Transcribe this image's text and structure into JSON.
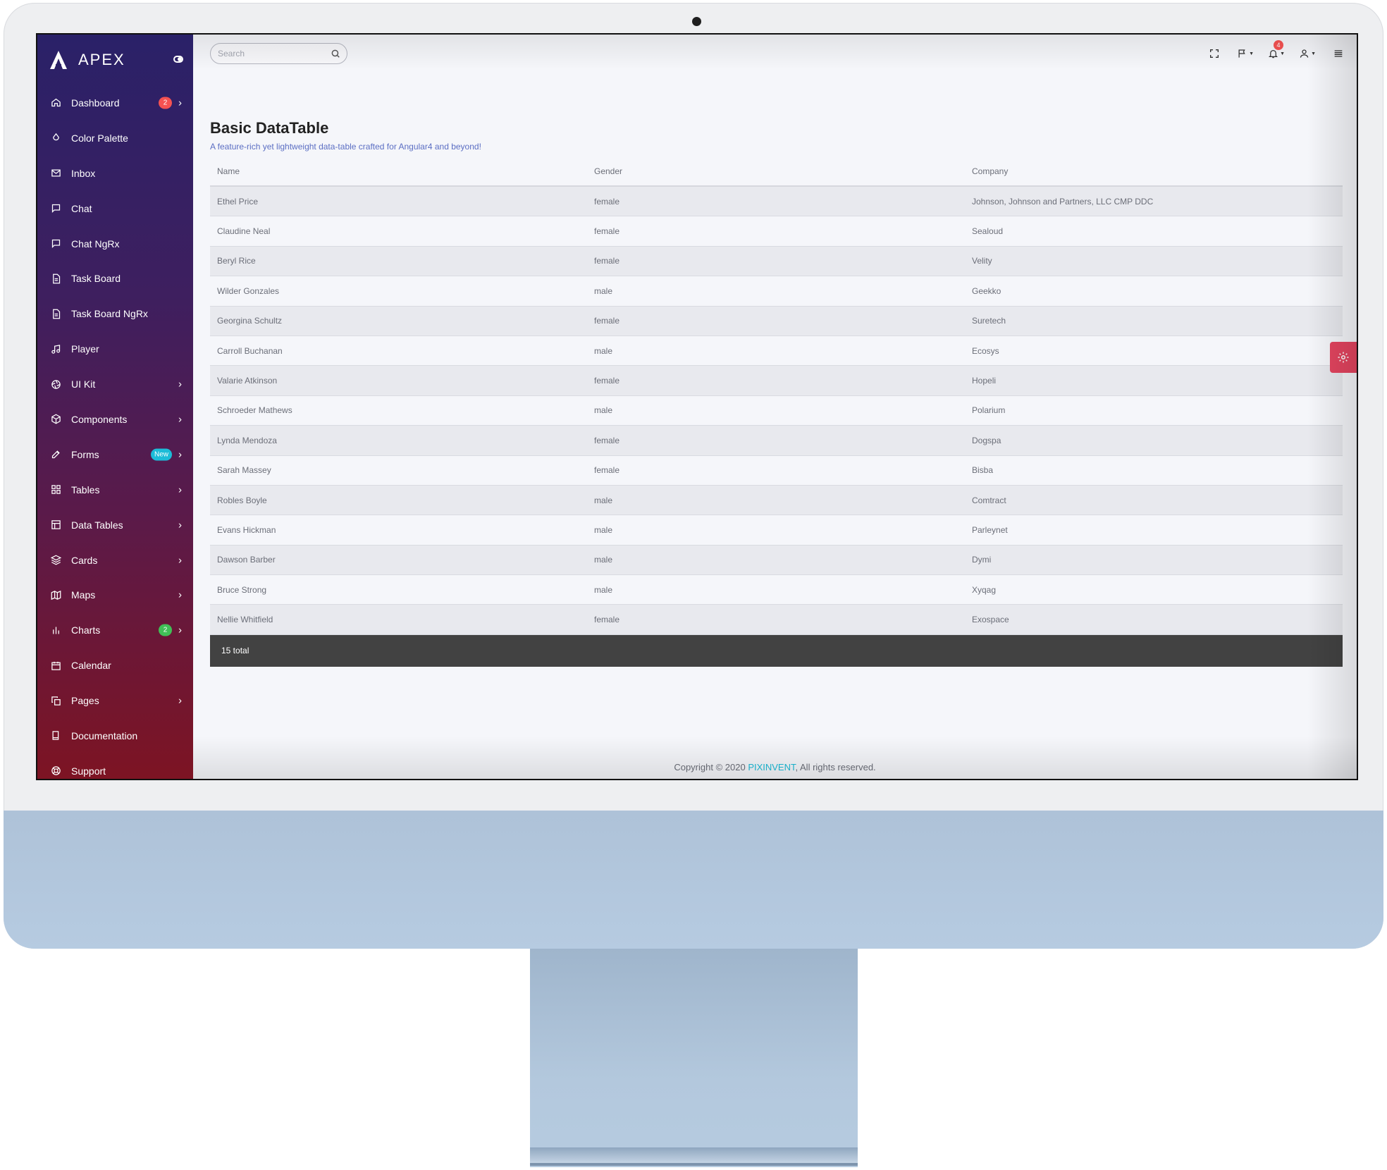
{
  "brand": {
    "name": "APEX"
  },
  "search": {
    "placeholder": "Search"
  },
  "sidebar": {
    "items": [
      {
        "label": "Dashboard",
        "icon": "home-icon",
        "badge": "2",
        "badge_color": "#f55252",
        "chevron": true
      },
      {
        "label": "Color Palette",
        "icon": "droplet-icon",
        "chevron": false
      },
      {
        "label": "Inbox",
        "icon": "mail-icon",
        "chevron": false
      },
      {
        "label": "Chat",
        "icon": "message-square-icon",
        "chevron": false
      },
      {
        "label": "Chat NgRx",
        "icon": "message-square-icon",
        "chevron": false
      },
      {
        "label": "Task Board",
        "icon": "file-text-icon",
        "chevron": false
      },
      {
        "label": "Task Board NgRx",
        "icon": "file-text-icon",
        "chevron": false
      },
      {
        "label": "Player",
        "icon": "music-icon",
        "chevron": false
      },
      {
        "label": "UI Kit",
        "icon": "aperture-icon",
        "chevron": true
      },
      {
        "label": "Components",
        "icon": "box-icon",
        "chevron": true
      },
      {
        "label": "Forms",
        "icon": "edit-icon",
        "badge": "New",
        "badge_color": "#1cbcd8",
        "chevron": true
      },
      {
        "label": "Tables",
        "icon": "grid-icon",
        "chevron": true
      },
      {
        "label": "Data Tables",
        "icon": "layout-icon",
        "chevron": true
      },
      {
        "label": "Cards",
        "icon": "layers-icon",
        "chevron": true
      },
      {
        "label": "Maps",
        "icon": "map-icon",
        "chevron": true
      },
      {
        "label": "Charts",
        "icon": "bar-chart-icon",
        "badge": "2",
        "badge_color": "#40c057",
        "chevron": true
      },
      {
        "label": "Calendar",
        "icon": "calendar-icon",
        "chevron": false
      },
      {
        "label": "Pages",
        "icon": "copy-icon",
        "chevron": true
      },
      {
        "label": "Documentation",
        "icon": "book-icon",
        "chevron": false
      },
      {
        "label": "Support",
        "icon": "life-buoy-icon",
        "chevron": false
      }
    ]
  },
  "navbar": {
    "notification_count": "4"
  },
  "page": {
    "title": "Basic DataTable",
    "subtitle": "A feature-rich yet lightweight data-table crafted for Angular4 and beyond!"
  },
  "table": {
    "columns": [
      "Name",
      "Gender",
      "Company"
    ],
    "rows": [
      [
        "Ethel Price",
        "female",
        "Johnson, Johnson and Partners, LLC CMP DDC"
      ],
      [
        "Claudine Neal",
        "female",
        "Sealoud"
      ],
      [
        "Beryl Rice",
        "female",
        "Velity"
      ],
      [
        "Wilder Gonzales",
        "male",
        "Geekko"
      ],
      [
        "Georgina Schultz",
        "female",
        "Suretech"
      ],
      [
        "Carroll Buchanan",
        "male",
        "Ecosys"
      ],
      [
        "Valarie Atkinson",
        "female",
        "Hopeli"
      ],
      [
        "Schroeder Mathews",
        "male",
        "Polarium"
      ],
      [
        "Lynda Mendoza",
        "female",
        "Dogspa"
      ],
      [
        "Sarah Massey",
        "female",
        "Bisba"
      ],
      [
        "Robles Boyle",
        "male",
        "Comtract"
      ],
      [
        "Evans Hickman",
        "male",
        "Parleynet"
      ],
      [
        "Dawson Barber",
        "male",
        "Dymi"
      ],
      [
        "Bruce Strong",
        "male",
        "Xyqag"
      ],
      [
        "Nellie Whitfield",
        "female",
        "Exospace"
      ]
    ],
    "footer": "15 total"
  },
  "footer": {
    "copyright_prefix": "Copyright © 2020 ",
    "brand_link": "PIXINVENT",
    "copyright_suffix": ", All rights reserved."
  },
  "colors": {
    "accent": "#1cbcd8",
    "danger": "#f55252",
    "success": "#40c057",
    "table_footer": "#424242"
  }
}
